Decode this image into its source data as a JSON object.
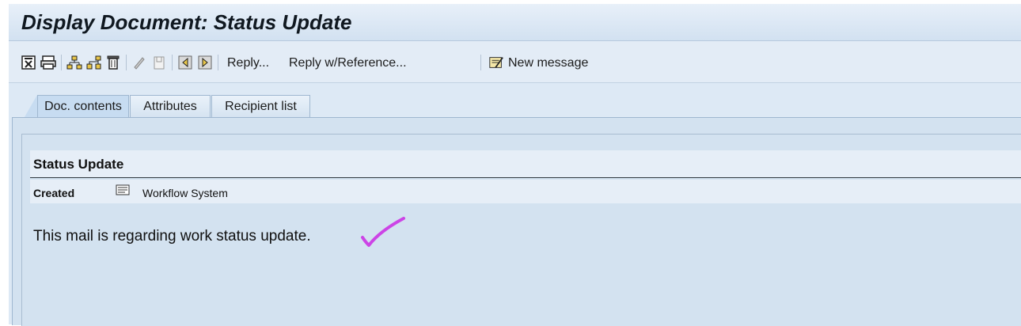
{
  "window": {
    "title": "Display Document: Status Update"
  },
  "toolbar": {
    "icons": [
      "close-document-icon",
      "print-icon",
      "hierarchy-icon",
      "structure-icon",
      "delete-icon",
      "pencil-icon",
      "bin-icon",
      "previous-document-icon",
      "next-document-icon",
      "new-message-icon"
    ],
    "reply_label": "Reply...",
    "reply_ref_label": "Reply w/Reference...",
    "new_message_label": "New message"
  },
  "tabs": [
    {
      "label": "Doc. contents",
      "active": true
    },
    {
      "label": "Attributes",
      "active": false
    },
    {
      "label": "Recipient list",
      "active": false
    }
  ],
  "document": {
    "title": "Status Update",
    "created_label": "Created",
    "created_icon": "document-list-icon",
    "created_by": "Workflow System",
    "body": "This mail is regarding work status update."
  },
  "annotation": {
    "mark": "checkmark",
    "color": "#cc44e6"
  },
  "colors": {
    "background": "#dde9f5",
    "panel": "#d3e2f0",
    "header_strip": "#e6eef7",
    "active_tab": "#c7dcf1"
  }
}
